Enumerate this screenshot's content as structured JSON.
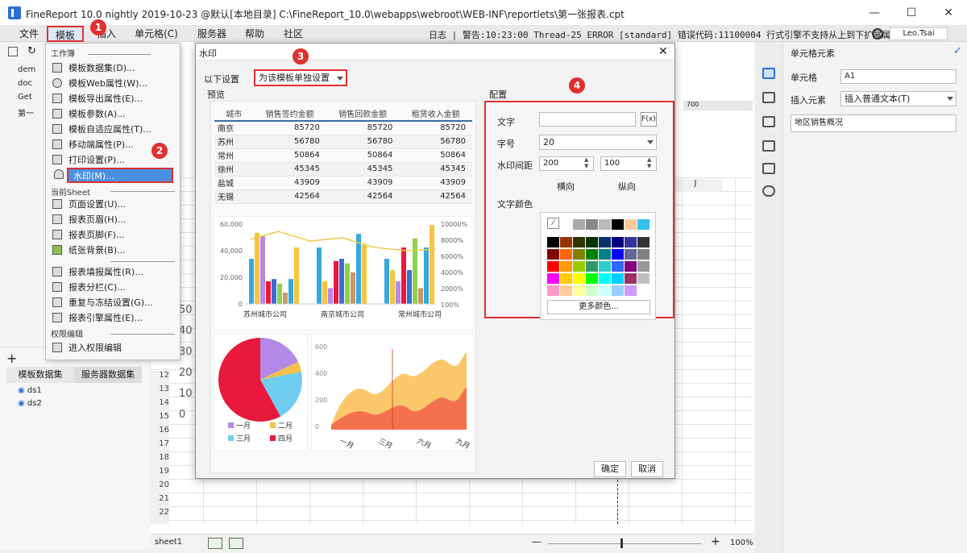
{
  "window": {
    "title": "FineReport 10.0 nightly 2019-10-23 @默认[本地目录]    C:\\FineReport_10.0\\webapps\\webroot\\WEB-INF\\reportlets\\第一张报表.cpt",
    "min": "—",
    "max": "☐",
    "close": "✕"
  },
  "menus": [
    "文件",
    "模板",
    "插入",
    "单元格(C)",
    "服务器",
    "帮助",
    "社区"
  ],
  "status": "日志 | 警告:10:23:00 Thread-25 ERROR [standard] 错误代码:11100004 行式引擎不支持从上到下扩展属性...",
  "user": "Leo.Tsai",
  "left_tree": [
    "dem",
    "doc",
    "Get",
    "第一"
  ],
  "dropdown": {
    "section1": "工作簿",
    "items1": [
      "模板数据集(D)...",
      "模板Web属性(W)...",
      "模板导出属性(E)...",
      "模板参数(A)...",
      "模板自适应属性(T)...",
      "移动端属性(P)...",
      "打印设置(P)...",
      "水印(M)..."
    ],
    "section2": "当前Sheet",
    "items2": [
      "页面设置(U)...",
      "报表页眉(H)...",
      "报表页脚(F)...",
      "纸张背景(B)...",
      "报表填报属性(R)...",
      "报表分栏(C)...",
      "重复与冻结设置(G)...",
      "报表引擎属性(E)..."
    ],
    "section3": "权限编辑",
    "items3": [
      "进入权限编辑"
    ]
  },
  "badges": [
    "1",
    "2",
    "3",
    "4"
  ],
  "dialog": {
    "title": "水印",
    "apply_label": "以下设置",
    "apply_value": "为该模板单独设置",
    "preview_label": "预览",
    "config_label": "配置",
    "text_label": "文字",
    "text_value": "",
    "formula_label": "F(x)",
    "size_label": "字号",
    "size_value": "20",
    "gap_label": "水印间距",
    "gap_h": "200",
    "gap_v": "100",
    "gap_h_label": "横向",
    "gap_v_label": "纵向",
    "color_label": "文字颜色",
    "more_colors": "更多颜色...",
    "ok": "确定",
    "cancel": "取消"
  },
  "preview_table": {
    "headers": [
      "城市",
      "销售签约金额",
      "销售回款金额",
      "租赁收入金额"
    ],
    "rows": [
      [
        "南京",
        "85720",
        "85720",
        "85720"
      ],
      [
        "苏州",
        "56780",
        "56780",
        "56780"
      ],
      [
        "常州",
        "50864",
        "50864",
        "50864"
      ],
      [
        "徐州",
        "45345",
        "45345",
        "45345"
      ],
      [
        "盐城",
        "43909",
        "43909",
        "43909"
      ],
      [
        "无锡",
        "42564",
        "42564",
        "42564"
      ]
    ]
  },
  "chart_data": [
    {
      "type": "bar",
      "categories": [
        "苏州城市公司",
        "南京城市公司",
        "常州城市公司"
      ],
      "y_ticks": [
        "60,000",
        "40,000",
        "20,000",
        "0"
      ],
      "y2_ticks": [
        "10000%",
        "8000%",
        "6000%",
        "4000%",
        "2000%",
        "100%"
      ]
    },
    {
      "type": "pie",
      "legend": [
        "一月",
        "二月",
        "三月",
        "四月"
      ],
      "colors": [
        "#b388e6",
        "#f2c04a",
        "#6fcdf2",
        "#e8193c"
      ],
      "values": [
        18,
        4,
        20,
        58
      ]
    },
    {
      "type": "area",
      "categories": [
        "一月",
        "三月",
        "六月",
        "九月"
      ],
      "y_ticks": [
        "600",
        "400",
        "200",
        "0"
      ]
    }
  ],
  "right_panel": {
    "header": "单元格元素",
    "cell_label": "单元格",
    "cell_value": "A1",
    "insert_label": "插入元素",
    "insert_value": "插入普通文本(T)",
    "content": "地区销售概况"
  },
  "datasets": {
    "tab1": "模板数据集",
    "tab2": "服务器数据集",
    "items": [
      "ds1",
      "ds2"
    ]
  },
  "rows": [
    "12",
    "13",
    "14",
    "15",
    "16",
    "17",
    "18",
    "19",
    "20",
    "21",
    "22"
  ],
  "col_label": "J",
  "ruler": "700",
  "sheet_tab": "sheet1",
  "zoom": "100%",
  "left_nums": [
    "50",
    "40",
    "30",
    "20",
    "10",
    "0"
  ]
}
